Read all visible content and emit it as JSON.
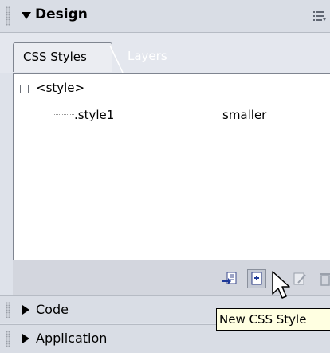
{
  "design_panel": {
    "title": "Design",
    "tabs": [
      {
        "label": "CSS Styles",
        "selected": true
      },
      {
        "label": "Layers",
        "selected": false
      }
    ],
    "styles": [
      {
        "name": "<style>",
        "expanded": true
      },
      {
        "name": ".style1",
        "value": "smaller"
      }
    ],
    "toolbar": {
      "icons": [
        "attach-style-sheet-icon",
        "new-css-style-icon",
        "edit-style-icon",
        "delete-style-icon"
      ]
    }
  },
  "collapsed_panels": [
    {
      "title": "Code"
    },
    {
      "title": "Application"
    }
  ],
  "tooltip": {
    "text": "New CSS Style"
  },
  "colors": {
    "header_bg": "#d9dde5",
    "panel_bg": "#ffffff",
    "tooltip_bg": "#ffffe1",
    "tab_inactive_text": "#ffffff"
  }
}
